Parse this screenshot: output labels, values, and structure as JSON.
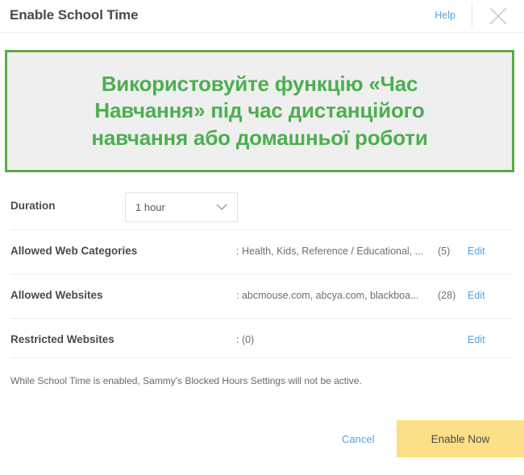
{
  "header": {
    "title": "Enable School Time",
    "help_label": "Help",
    "close_icon": "close-icon"
  },
  "banner": {
    "lines": [
      "Використовуйте функцію «Час",
      "Навчання» під час дистанційого",
      "навчання або домашньої роботи"
    ],
    "text": "Використовуйте функцію «Час Навчання» під час дистанційого навчання або домашньої роботи",
    "border_color": "#5cab46",
    "text_color": "#4caf50",
    "background_color": "#efefef"
  },
  "duration": {
    "label": "Duration",
    "value": "1 hour",
    "chevron_icon": "chevron-down-icon"
  },
  "settings": {
    "rows": [
      {
        "label": "Allowed Web Categories",
        "value": ": Health, Kids, Reference / Educational, ...",
        "count": "(5)",
        "edit_label": "Edit"
      },
      {
        "label": "Allowed Websites",
        "value": ": abcmouse.com, abcya.com, blackboa...",
        "count": "(28)",
        "edit_label": "Edit"
      },
      {
        "label": "Restricted Websites",
        "value": ": (0)",
        "count": "",
        "edit_label": "Edit"
      }
    ]
  },
  "footnote": "While School Time is enabled, Sammy's Blocked Hours Settings will not be active.",
  "footer": {
    "cancel_label": "Cancel",
    "enable_label": "Enable Now",
    "enable_color": "#fcdf87",
    "link_color": "#50a6dd"
  }
}
